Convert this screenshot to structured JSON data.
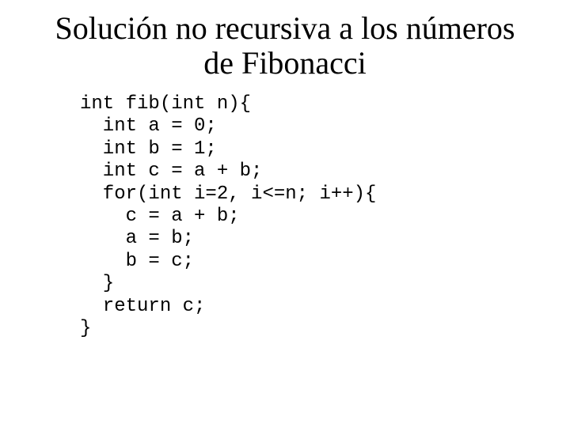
{
  "slide": {
    "title_lines": [
      "Solución no recursiva a los números",
      "de Fibonacci"
    ],
    "code_lines": [
      "int fib(int n){",
      "  int a = 0;",
      "  int b = 1;",
      "  int c = a + b;",
      "  for(int i=2, i<=n; i++){",
      "    c = a + b;",
      "    a = b;",
      "    b = c;",
      "  }",
      "  return c;",
      "}"
    ]
  }
}
